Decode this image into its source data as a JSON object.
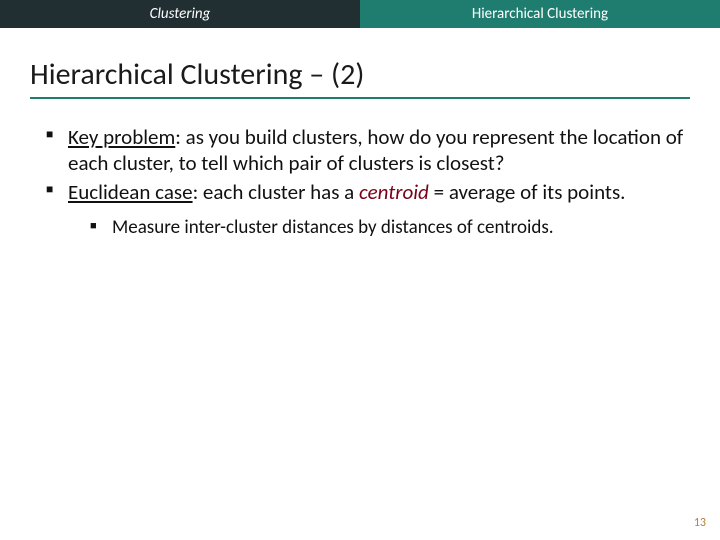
{
  "header": {
    "left": "Clustering",
    "right": "Hierarchical Clustering"
  },
  "title": "Hierarchical Clustering – (2)",
  "bullets": {
    "b1": {
      "lead": "Key problem",
      "rest": ": as you build clusters, how do you represent the location of each cluster, to tell which pair of clusters is closest?"
    },
    "b2": {
      "lead": "Euclidean case",
      "mid": ": each cluster has a ",
      "em": "centroid",
      "tail": " = average of its points."
    },
    "b2a": "Measure inter-cluster distances by distances of centroids."
  },
  "page_number": "13"
}
